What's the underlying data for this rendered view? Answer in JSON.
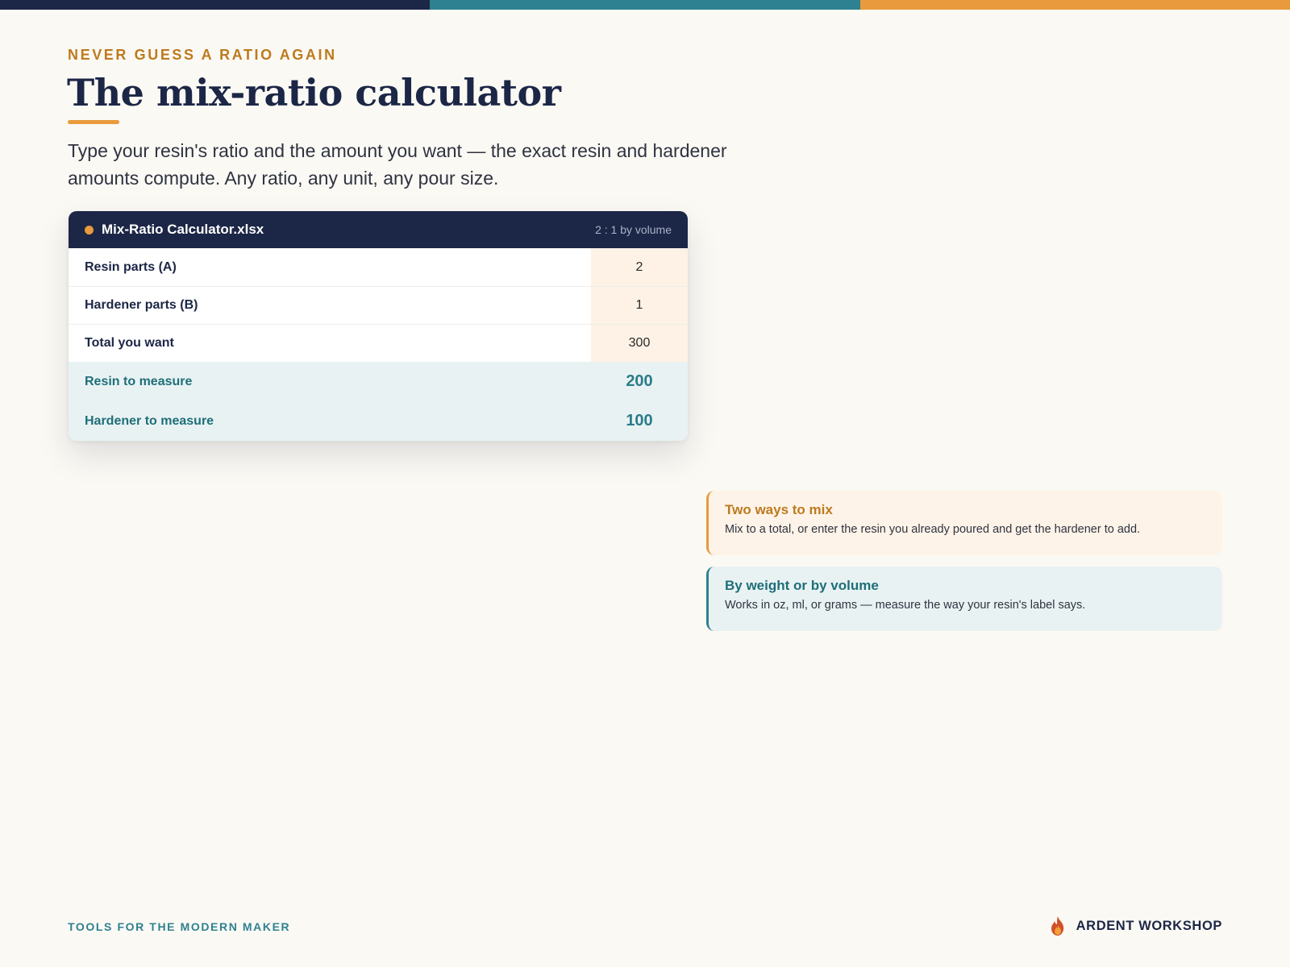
{
  "eyebrow": "NEVER GUESS A RATIO AGAIN",
  "title": "The mix-ratio calculator",
  "lede": "Type your resin's ratio and the amount you want — the exact resin and hardener amounts compute. Any ratio, any unit, any pour size.",
  "sheet": {
    "filename": "Mix-Ratio Calculator.xlsx",
    "ratio_label": "2 : 1 by volume",
    "inputs": [
      {
        "label": "Resin parts (A)",
        "value": "2"
      },
      {
        "label": "Hardener parts (B)",
        "value": "1"
      },
      {
        "label": "Total you want",
        "value": "300"
      }
    ],
    "outputs": [
      {
        "label": "Resin to measure",
        "value": "200"
      },
      {
        "label": "Hardener to measure",
        "value": "100"
      }
    ]
  },
  "callouts": [
    {
      "title": "Two ways to mix",
      "body": "Mix to a total, or enter the resin you already poured and get the hardener to add."
    },
    {
      "title": "By weight or by volume",
      "body": "Works in oz, ml, or grams — measure the way your resin's label says."
    }
  ],
  "footer": {
    "tagline": "TOOLS FOR THE MODERN MAKER",
    "brand": "ARDENT WORKSHOP",
    "brand_icon": "flame-icon"
  },
  "colors": {
    "navy": "#1c2646",
    "teal": "#2e8190",
    "orange": "#e89a3c",
    "background": "#fbf9f4"
  }
}
